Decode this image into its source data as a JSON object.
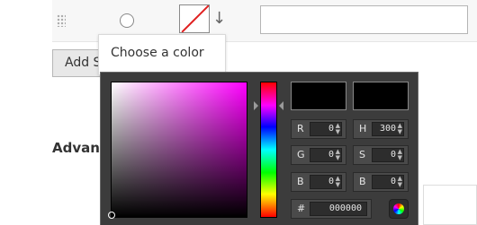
{
  "option_row": {
    "drag_icon": "drag-handle-icon",
    "radio_icon": "radio-button",
    "color_swatch_icon": "no-color-swatch-icon",
    "sort_icon": "arrow-down-icon",
    "text_value": ""
  },
  "add_button": {
    "label": "Add S"
  },
  "section": {
    "advanced_label": "Advan"
  },
  "tooltip": {
    "label": "Choose a color"
  },
  "colorpicker": {
    "selected_hue_color": "#ff00ff",
    "fields": [
      {
        "label": "R",
        "value": "0"
      },
      {
        "label": "H",
        "value": "300"
      },
      {
        "label": "G",
        "value": "0"
      },
      {
        "label": "S",
        "value": "0"
      },
      {
        "label": "B",
        "value": "0"
      },
      {
        "label": "B",
        "value": "0"
      }
    ],
    "hex_label": "#",
    "hex_value": "000000",
    "wheel_icon": "color-wheel-icon"
  },
  "colors": {
    "picker_background": "#3c3c3c",
    "preview_new": "#000000",
    "preview_current": "#000000",
    "no_color_slash": "#e02020"
  }
}
